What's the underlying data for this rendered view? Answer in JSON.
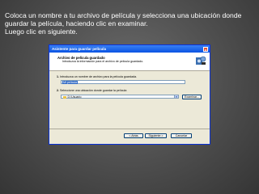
{
  "caption": {
    "line1": "Coloca un nombre a tu archivo de película y selecciona una ubicación donde",
    "line2": "guardar la película, haciendo clic en examinar.",
    "line3": "Luego clic en siguiente."
  },
  "dialog": {
    "title": "Asistente para guardar película",
    "close_label": "x",
    "header_title": "Archivo de película guardado",
    "header_subtitle": "Introduzca la información para el archivo de película guardado.",
    "step1_number": "1.",
    "step1_label": "Introduzca un nombre de archivo para la película guardada.",
    "filename_value": "Mi película",
    "step2_number": "2.",
    "step2_label": "Seleccione una ubicación donde guardar la película",
    "location_value": "D:\\Usuario",
    "browse_label": "Examinar...",
    "back_label": "< Atrás",
    "next_label": "Siguiente >",
    "cancel_label": "Cancelar"
  }
}
